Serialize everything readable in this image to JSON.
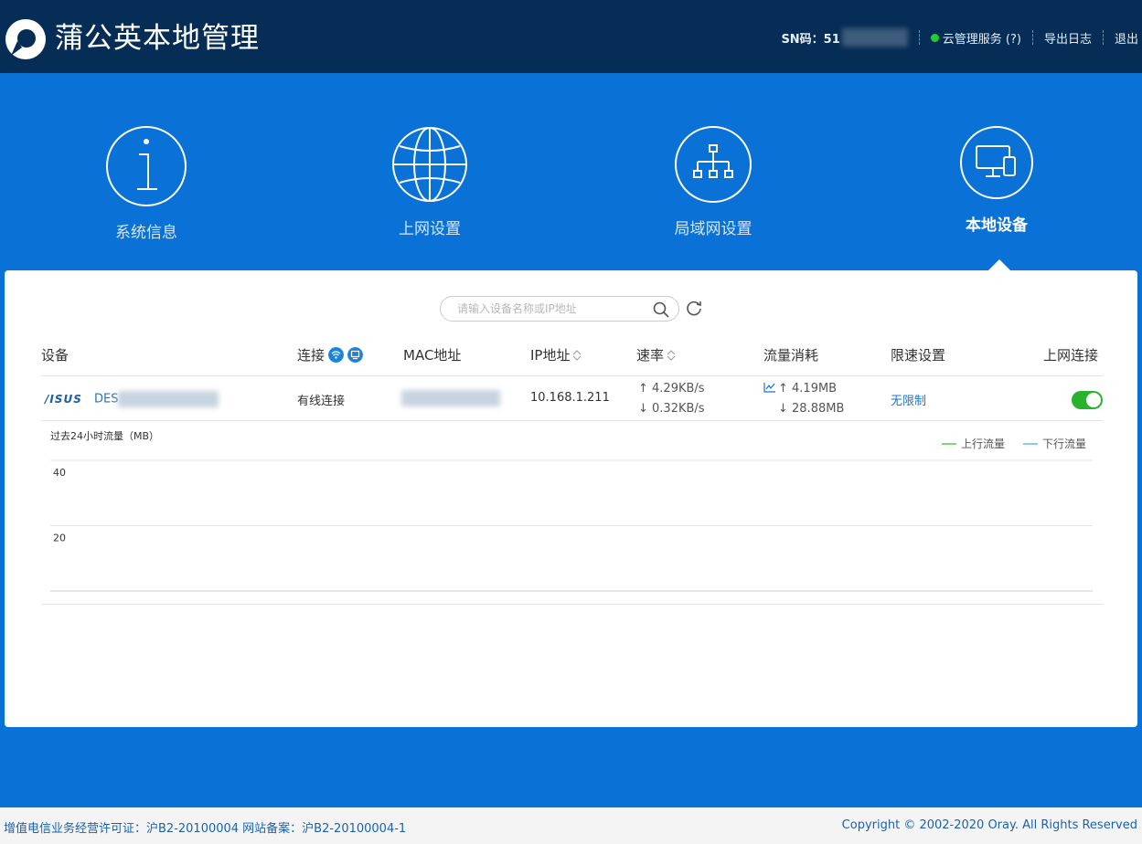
{
  "header": {
    "app_title": "蒲公英本地管理",
    "sn_label": "SN码：51",
    "cloud_service": "云管理服务 (?)",
    "export_log": "导出日志",
    "logout": "退出",
    "colors": {
      "background": "#062d55",
      "status_online": "#22cc33"
    }
  },
  "nav": {
    "items": [
      {
        "label": "系统信息",
        "icon": "info-icon"
      },
      {
        "label": "上网设置",
        "icon": "globe-icon"
      },
      {
        "label": "局域网设置",
        "icon": "network-tree-icon"
      },
      {
        "label": "本地设备",
        "icon": "devices-icon"
      }
    ],
    "active_index": 3
  },
  "search": {
    "placeholder": "请输入设备名称或IP地址"
  },
  "table": {
    "headers": {
      "device": "设备",
      "connection": "连接",
      "mac": "MAC地址",
      "ip": "IP地址",
      "rate": "速率",
      "traffic": "流量消耗",
      "limit": "限速设置",
      "online": "上网连接"
    },
    "rows": [
      {
        "brand": "/ISUS",
        "name": "DES",
        "connection": "有线连接",
        "ip": "10.168.1.211",
        "rate_up": "↑ 4.29KB/s",
        "rate_down": "↓ 0.32KB/s",
        "traffic_up": "↑ 4.19MB",
        "traffic_down": "↓ 28.88MB",
        "limit": "无限制",
        "online_enabled": true
      }
    ]
  },
  "chart": {
    "title": "过去24小时流量（MB）",
    "legend_up": "上行流量",
    "legend_down": "下行流量"
  },
  "chart_data": {
    "type": "line",
    "title": "过去24小时流量（MB）",
    "ylim": [
      0,
      40
    ],
    "yticks": [
      20,
      40
    ],
    "grid": true,
    "legend_placement": "top-right",
    "series": [
      {
        "name": "上行流量",
        "color": "#7fd67f",
        "values": []
      },
      {
        "name": "下行流量",
        "color": "#8fc9f0",
        "values": []
      }
    ]
  },
  "footer": {
    "license": "增值电信业务经营许可证：沪B2-20100004 网站备案：沪B2-20100004-1",
    "copyright": "Copyright © 2002-2020 Oray. All Rights Reserved"
  },
  "colors": {
    "accent": "#0a72d6",
    "link": "#1b76c8",
    "toggle_on": "#29b22e"
  }
}
